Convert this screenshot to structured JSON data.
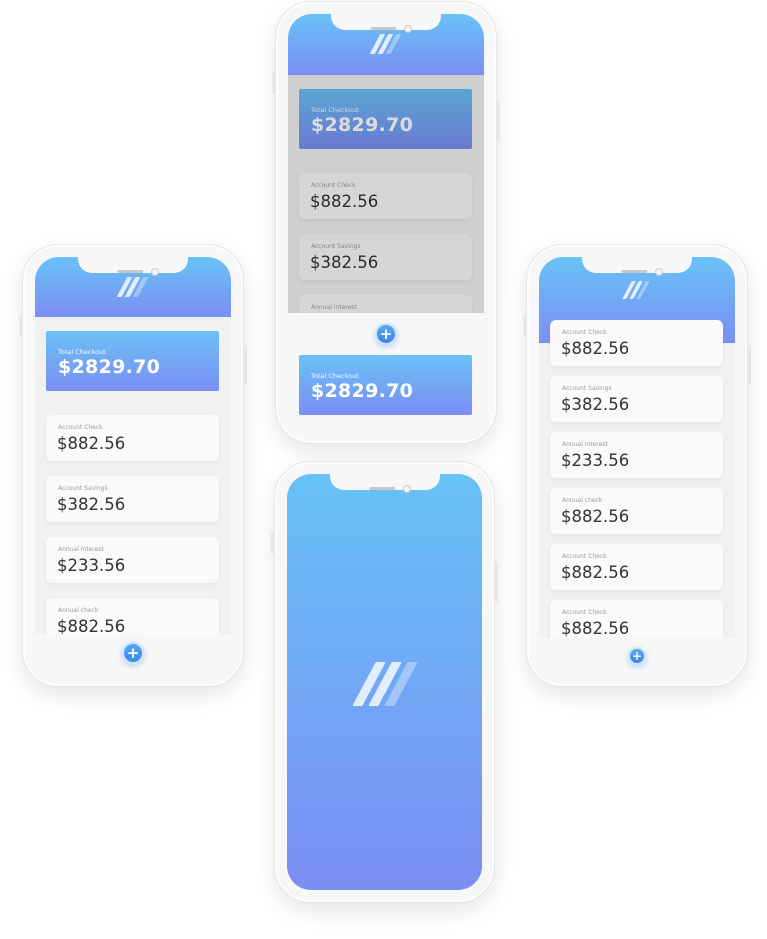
{
  "colors": {
    "gradient_top": "#68c2f7",
    "gradient_bottom": "#7b8ef3",
    "fab": "#3b86e8"
  },
  "icons": {
    "logo": "logo-stripes-icon",
    "add": "plus-icon"
  },
  "left_screen": {
    "total": {
      "label": "Total Checkout",
      "value": "$2829.70"
    },
    "accounts": [
      {
        "label": "Account Check",
        "value": "$882.56"
      },
      {
        "label": "Account Savings",
        "value": "$382.56"
      },
      {
        "label": "Annual interest",
        "value": "$233.56"
      },
      {
        "label": "Annual  check",
        "value": "$882.56"
      }
    ],
    "add_label": "+"
  },
  "top_screen": {
    "total": {
      "label": "Total Checkout",
      "value": "$2829.70"
    },
    "accounts": [
      {
        "label": "Account Check",
        "value": "$882.56"
      },
      {
        "label": "Account Savings",
        "value": "$382.56"
      },
      {
        "label": "Annual interest",
        "value": ""
      }
    ],
    "add_label": "+",
    "drawer_total": {
      "label": "Total Checkout",
      "value": "$2829.70"
    }
  },
  "right_screen": {
    "accounts": [
      {
        "label": "Account Check",
        "value": "$882.56"
      },
      {
        "label": "Account Savings",
        "value": "$382.56"
      },
      {
        "label": "Annual interest",
        "value": "$233.56"
      },
      {
        "label": "Annual  check",
        "value": "$882.56"
      },
      {
        "label": "Account Check",
        "value": "$882.56"
      },
      {
        "label": "Account Check",
        "value": "$882.56"
      }
    ],
    "add_label": "+"
  },
  "splash_screen": {}
}
